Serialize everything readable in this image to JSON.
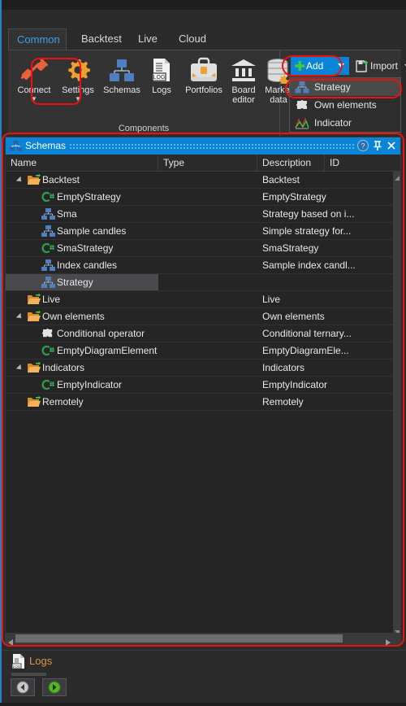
{
  "window": {
    "title": "Schemas"
  },
  "ribbon": {
    "tabs": [
      {
        "label": "Common",
        "active": true
      },
      {
        "label": "Backtest",
        "active": false
      },
      {
        "label": "Live",
        "active": false
      },
      {
        "label": "Cloud",
        "active": false
      }
    ],
    "group_label": "Components",
    "buttons": [
      {
        "label": "Connect",
        "icon": "plug-icon",
        "caret": "▼"
      },
      {
        "label": "Settings",
        "icon": "gear-icon",
        "caret": "▼"
      },
      {
        "label": "Schemas",
        "icon": "schema-tree-icon",
        "caret": ""
      },
      {
        "label": "Logs",
        "icon": "log-document-icon",
        "caret": ""
      },
      {
        "label": "Portfolios",
        "icon": "briefcase-icon",
        "caret": ""
      },
      {
        "label": "Board editor",
        "label_line1": "Board",
        "label_line2": "editor",
        "icon": "bank-icon",
        "caret": ""
      },
      {
        "label": "Market data",
        "label_line1": "Market",
        "label_line2": "data",
        "icon": "database-gear-icon",
        "caret": ""
      }
    ],
    "add_button": {
      "label": "Add",
      "icon": "plus-icon",
      "caret": "▼"
    },
    "import_button": {
      "label": "Import",
      "icon": "import-icon",
      "caret": "▼"
    }
  },
  "add_menu": {
    "items": [
      {
        "label": "Strategy",
        "icon": "schema-tree-icon",
        "highlighted": true
      },
      {
        "label": "Own elements",
        "icon": "puzzle-icon",
        "highlighted": false
      },
      {
        "label": "Indicator",
        "icon": "indicator-curve-icon",
        "highlighted": false
      }
    ]
  },
  "panel": {
    "title": "Schemas",
    "title_icon": "schema-tree-icon",
    "buttons": [
      {
        "name": "help-icon",
        "glyph": "?"
      },
      {
        "name": "pin-icon",
        "glyph": "📌"
      },
      {
        "name": "close-icon",
        "glyph": "✕"
      }
    ],
    "columns": [
      "Name",
      "Type",
      "Description",
      "ID"
    ],
    "rows": [
      {
        "name": "Backtest",
        "type": "",
        "description": "Backtest",
        "id": "",
        "level": 0,
        "icon": "folder-icon",
        "expander": true,
        "selected": false
      },
      {
        "name": "EmptyStrategy",
        "type": "",
        "description": "EmptyStrategy",
        "id": "",
        "level": 1,
        "icon": "csharp-icon",
        "expander": false,
        "selected": false
      },
      {
        "name": "Sma",
        "type": "",
        "description": "Strategy based on i...",
        "id": "",
        "level": 1,
        "icon": "schema-tree-icon",
        "expander": false,
        "selected": false
      },
      {
        "name": "Sample candles",
        "type": "",
        "description": "Simple strategy for...",
        "id": "",
        "level": 1,
        "icon": "schema-tree-icon",
        "expander": false,
        "selected": false
      },
      {
        "name": "SmaStrategy",
        "type": "",
        "description": "SmaStrategy",
        "id": "",
        "level": 1,
        "icon": "csharp-icon",
        "expander": false,
        "selected": false
      },
      {
        "name": "Index candles",
        "type": "",
        "description": "Sample index candl...",
        "id": "",
        "level": 1,
        "icon": "schema-tree-icon",
        "expander": false,
        "selected": false
      },
      {
        "name": "Strategy",
        "type": "",
        "description": "",
        "id": "",
        "level": 1,
        "icon": "schema-tree-icon",
        "expander": false,
        "selected": true
      },
      {
        "name": "Live",
        "type": "",
        "description": "Live",
        "id": "",
        "level": 0,
        "icon": "folder-icon",
        "expander": false,
        "selected": false
      },
      {
        "name": "Own elements",
        "type": "",
        "description": "Own elements",
        "id": "",
        "level": 0,
        "icon": "folder-icon",
        "expander": true,
        "selected": false
      },
      {
        "name": "Conditional operator",
        "type": "",
        "description": "Conditional ternary...",
        "id": "",
        "level": 1,
        "icon": "puzzle-icon",
        "expander": false,
        "selected": false
      },
      {
        "name": "EmptyDiagramElement",
        "type": "",
        "description": "EmptyDiagramEle...",
        "id": "",
        "level": 1,
        "icon": "csharp-icon",
        "expander": false,
        "selected": false
      },
      {
        "name": "Indicators",
        "type": "",
        "description": "Indicators",
        "id": "",
        "level": 0,
        "icon": "folder-icon",
        "expander": true,
        "selected": false
      },
      {
        "name": "EmptyIndicator",
        "type": "",
        "description": "EmptyIndicator",
        "id": "",
        "level": 1,
        "icon": "csharp-icon",
        "expander": false,
        "selected": false
      },
      {
        "name": "Remotely",
        "type": "",
        "description": "Remotely",
        "id": "",
        "level": 0,
        "icon": "folder-icon",
        "expander": false,
        "selected": false
      }
    ]
  },
  "bottom_dock": {
    "title": "Logs",
    "title_icon": "log-document-icon",
    "back_button": "back-arrow-icon",
    "forward_button": "forward-arrow-icon"
  },
  "colors": {
    "accent_blue": "#0a84d6",
    "annotation_red": "#ee1111",
    "tab_active_text": "#3f9fe0",
    "logs_title": "#e0943c",
    "panel_bg": "#252526",
    "ribbon_bg": "#333334"
  }
}
